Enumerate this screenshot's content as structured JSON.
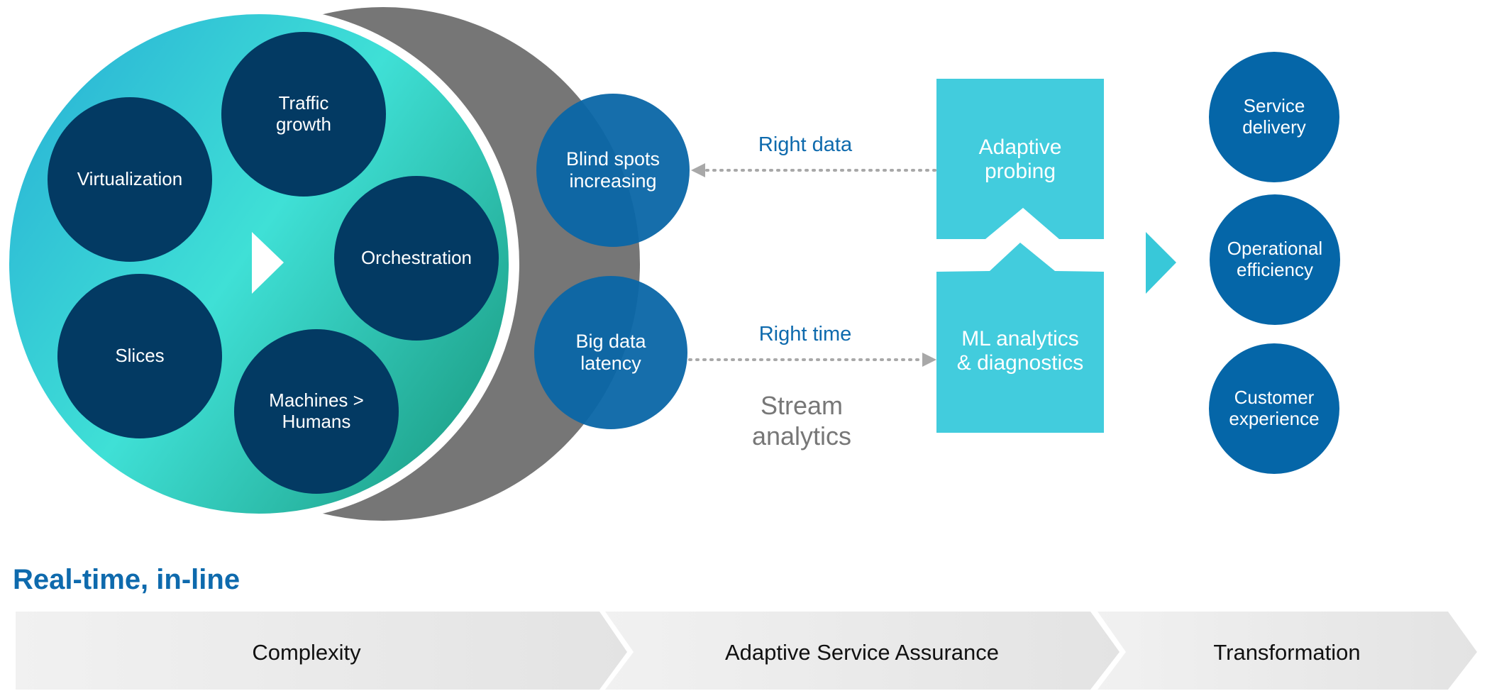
{
  "colors": {
    "dark_navy": "#033a63",
    "mid_blue": "#0c6aa8",
    "cyan_box": "#42ccdd",
    "grey_crescent": "#767676",
    "teal_light": "#3fe0d4",
    "teal_dark": "#1f9e86",
    "accent_blue_text": "#0e6aad",
    "chevron_grey": "#e7e7e7"
  },
  "complexity_circle": {
    "play_icon": "play-triangle-icon",
    "drivers": [
      {
        "label": "Traffic\ngrowth"
      },
      {
        "label": "Virtualization"
      },
      {
        "label": "Orchestration"
      },
      {
        "label": "Slices"
      },
      {
        "label": "Machines >\nHumans"
      }
    ]
  },
  "challenges": [
    {
      "label": "Blind spots\nincreasing"
    },
    {
      "label": "Big data\nlatency"
    }
  ],
  "flows": {
    "right_data": {
      "label": "Right data",
      "direction": "to challenges"
    },
    "right_time": {
      "label": "Right time",
      "direction": "to analytics"
    },
    "stream_label": "Stream\nanalytics"
  },
  "solution_boxes": [
    {
      "label": "Adaptive\nprobing"
    },
    {
      "label": "ML analytics\n& diagnostics"
    }
  ],
  "outcomes": [
    {
      "label": "Service\ndelivery"
    },
    {
      "label": "Operational\nefficiency"
    },
    {
      "label": "Customer\nexperience"
    }
  ],
  "heading": "Real-time, in-line",
  "stages": [
    {
      "label": "Complexity"
    },
    {
      "label": "Adaptive Service Assurance"
    },
    {
      "label": "Transformation"
    }
  ]
}
